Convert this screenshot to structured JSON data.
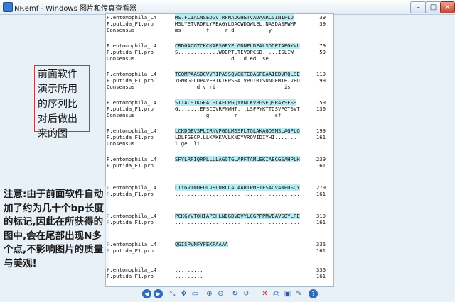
{
  "window": {
    "title": "NF.emf - Windows 图片和传真查看器",
    "min_symbol": "–",
    "max_symbol": "□",
    "close_symbol": "✕"
  },
  "alignment": {
    "blocks": [
      {
        "lines": [
          {
            "name": "P.entomophila_L4",
            "seq": "MS.FCIALNSEDGVTRFNADGHETVADAARCGINIPLD",
            "num": "39",
            "hl": true
          },
          {
            "name": "P.putida_F1.pro",
            "seq": "MSLYETVRDPLYPEAGYLDAQWDQWLEL.NASDASFWMP",
            "num": "39",
            "hl": false
          },
          {
            "name": "Consensus",
            "seq": "ms        f     r d           y",
            "num": "",
            "hl": false
          }
        ]
      },
      {
        "lines": [
          {
            "name": "P.entomophila_L4",
            "seq": "CRDGACGTCKCKAESGRYELGDNFLDEALSDDEIAEGYVL",
            "num": "79",
            "hl": true
          },
          {
            "name": "P.putida_F1.pro",
            "seq": "S.............WDDPTLTEVDPCSD.....ISLIW",
            "num": "59",
            "hl": false
          },
          {
            "name": "Consensus",
            "seq": "                  d   d ed  se",
            "num": "",
            "hl": false
          }
        ]
      },
      {
        "lines": [
          {
            "name": "P.entomophila_L4",
            "seq": "TCQMPAASDCVVRIPASSQVCKTEQASFEAAIEDVRQLSE",
            "num": "119",
            "hl": true
          },
          {
            "name": "P.putida_F1.pro",
            "seq": "YGNRGGLDPAVFRIKTEPSSATVPDTRTSNNGEMIEIVEQ",
            "num": "99",
            "hl": false
          },
          {
            "name": "Consensus",
            "seq": "       d v ri                      is",
            "num": "",
            "hl": false
          }
        ]
      },
      {
        "lines": [
          {
            "name": "P.entomophila_L4",
            "seq": "STIALSIKGEALSLAFLPGQYVNLKVPGSEQSRAYSFSS",
            "num": "159",
            "hl": true
          },
          {
            "name": "P.putida_F1.pro",
            "seq": "G.......EPSCQVRFNWHT...LSFPYKTTDSVFGTSVT",
            "num": "130",
            "hl": false
          },
          {
            "name": "Consensus",
            "seq": "          g        r            sf",
            "num": "",
            "hl": false
          }
        ]
      },
      {
        "lines": [
          {
            "name": "P.entomophila_L4",
            "seq": "LCKDGEVSFLIRNVPGGLMSSFLTGLAKAGDSMSLAGPLG",
            "num": "199",
            "hl": true
          },
          {
            "name": "P.putida_F1.pro",
            "seq": "LDLFGECP.LLKAKKVVLKNDYVRQVIDIYHI.......",
            "num": "161",
            "hl": false
          },
          {
            "name": "Consensus",
            "seq": "l ge  li      l",
            "num": "",
            "hl": false
          }
        ]
      },
      {
        "lines": [
          {
            "name": "P.entomophila_L4",
            "seq": "SFYLRPIQRPLLLLAGGTGLAPFTAMLEKIAECGSAHPLH",
            "num": "239",
            "hl": true
          },
          {
            "name": "P.putida_F1.pro",
            "seq": "........................................",
            "num": "161",
            "hl": false
          }
        ]
      },
      {
        "lines": [
          {
            "name": "P.entomophila_L4",
            "seq": "LIYGVTNDFDLVELDRLCALAARIPNFTFSACVANPDSQY",
            "num": "279",
            "hl": true
          },
          {
            "name": "P.putida_F1.pro",
            "seq": "........................................",
            "num": "161",
            "hl": false
          }
        ]
      },
      {
        "lines": [
          {
            "name": "P.entomophila_L4",
            "seq": "PCKGYVTQHIAPCHLNDGDVDVYLCGPPPMVEAVSQYLRE",
            "num": "319",
            "hl": true
          },
          {
            "name": "P.putida_F1.pro",
            "seq": "........................................",
            "num": "161",
            "hl": false
          }
        ]
      },
      {
        "lines": [
          {
            "name": "P.entomophila_L4",
            "seq": "QGISPVNFYFEKFAAAA",
            "num": "336",
            "hl": true
          },
          {
            "name": "P.putida_F1.pro",
            "seq": ".................",
            "num": "161",
            "hl": false
          }
        ]
      },
      {
        "lines": [
          {
            "name": "P.entomophila_L4",
            "seq": ".........",
            "num": "336",
            "hl": false
          },
          {
            "name": "P.putida_F1.pro",
            "seq": ".........",
            "num": "161",
            "hl": false
          }
        ]
      }
    ]
  },
  "annotations": {
    "note1": "前面软件演示所用的序列比对后做出来的图",
    "note2": "注意:由于前面软件自动加了约为几十个bp长度的标记,因此在所获得的图中,会在尾部出现N多个点,不影响图片的质量与美观!"
  },
  "toolbar": {
    "buttons": [
      {
        "name": "previous-image-button",
        "icon": "◀",
        "round": true
      },
      {
        "name": "next-image-button",
        "icon": "▶",
        "round": true
      },
      {
        "name": "best-fit-button",
        "icon": "⤡"
      },
      {
        "name": "actual-size-button",
        "icon": "✥"
      },
      {
        "name": "slideshow-button",
        "icon": "▭"
      },
      {
        "name": "zoom-in-button",
        "icon": "⊕"
      },
      {
        "name": "zoom-out-button",
        "icon": "⊖"
      },
      {
        "name": "rotate-clockwise-button",
        "icon": "↻"
      },
      {
        "name": "rotate-counterclockwise-button",
        "icon": "↺"
      },
      {
        "name": "delete-button",
        "icon": "✕",
        "red": true
      },
      {
        "name": "print-button",
        "icon": "⎙"
      },
      {
        "name": "save-copy-button",
        "icon": "▣"
      },
      {
        "name": "open-for-editing-button",
        "icon": "✎"
      },
      {
        "name": "help-button",
        "icon": "?",
        "round": true
      }
    ]
  }
}
